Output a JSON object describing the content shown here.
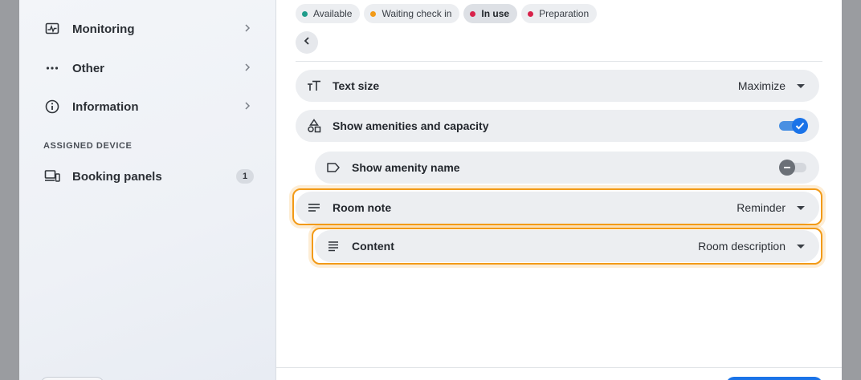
{
  "sidebar": {
    "items": [
      {
        "label": "Monitoring",
        "icon": "monitoring-icon"
      },
      {
        "label": "Other",
        "icon": "more-horizontal-icon"
      },
      {
        "label": "Information",
        "icon": "info-icon"
      }
    ],
    "section_label": "ASSIGNED DEVICE",
    "device_item": {
      "label": "Booking panels",
      "badge": "1",
      "icon": "devices-icon"
    }
  },
  "status_chips": [
    {
      "label": "Available",
      "color": "#1f9c8a",
      "active": false
    },
    {
      "label": "Waiting check in",
      "color": "#f29a17",
      "active": false
    },
    {
      "label": "In use",
      "color": "#d8224a",
      "active": true
    },
    {
      "label": "Preparation",
      "color": "#d8224a",
      "active": false
    }
  ],
  "settings": {
    "text_size": {
      "label": "Text size",
      "value": "Maximize"
    },
    "show_amenities": {
      "label": "Show amenities and capacity",
      "enabled": true
    },
    "show_amenity_name": {
      "label": "Show amenity name",
      "enabled": false
    },
    "room_note": {
      "label": "Room note",
      "value": "Reminder"
    },
    "content": {
      "label": "Content",
      "value": "Room description"
    }
  },
  "colors": {
    "accent": "#1a73e8",
    "highlight": "#f29a17"
  }
}
